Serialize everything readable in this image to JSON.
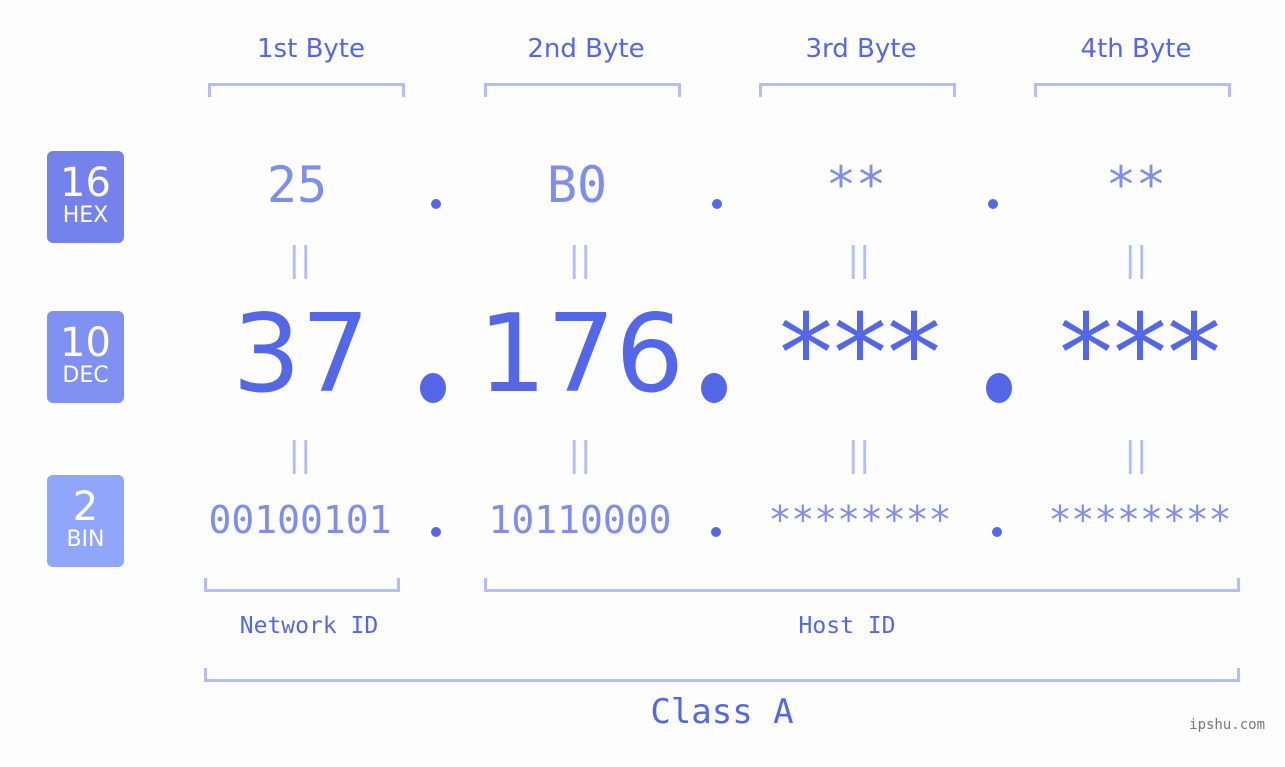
{
  "bytes": [
    {
      "label": "1st Byte",
      "hex": "25",
      "dec": "37",
      "bin": "00100101"
    },
    {
      "label": "2nd Byte",
      "hex": "B0",
      "dec": "176",
      "bin": "10110000"
    },
    {
      "label": "3rd Byte",
      "hex": "**",
      "dec": "***",
      "bin": "********"
    },
    {
      "label": "4th Byte",
      "hex": "**",
      "dec": "***",
      "bin": "********"
    }
  ],
  "badges": {
    "hex": {
      "num": "16",
      "label": "HEX",
      "color": "#7582ec"
    },
    "dec": {
      "num": "10",
      "label": "DEC",
      "color": "#8191f2"
    },
    "bin": {
      "num": "2",
      "label": "BIN",
      "color": "#8fa6fa"
    }
  },
  "equals_symbol": "||",
  "network_id_label": "Network ID",
  "host_id_label": "Host ID",
  "class_label": "Class A",
  "watermark": "ipshu.com",
  "colors": {
    "accent": "#5468e7",
    "light": "#7f8ded",
    "bracket": "#b3bdfa"
  }
}
